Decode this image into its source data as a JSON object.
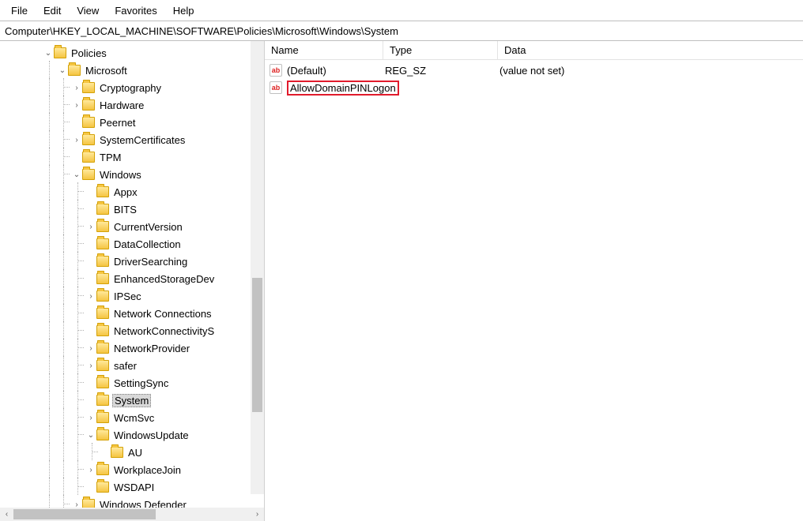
{
  "menu": {
    "file": "File",
    "edit": "Edit",
    "view": "View",
    "favorites": "Favorites",
    "help": "Help"
  },
  "address": "Computer\\HKEY_LOCAL_MACHINE\\SOFTWARE\\Policies\\Microsoft\\Windows\\System",
  "columns": {
    "name": "Name",
    "type": "Type",
    "data": "Data"
  },
  "values": [
    {
      "name": "(Default)",
      "type": "REG_SZ",
      "data": "(value not set)",
      "highlighted": false
    },
    {
      "name": "AllowDomainPINLogon",
      "type": "",
      "data": "",
      "highlighted": true
    }
  ],
  "tree": {
    "policies": "Policies",
    "microsoft": "Microsoft",
    "items": {
      "cryptography": "Cryptography",
      "hardware": "Hardware",
      "peernet": "Peernet",
      "systemcertificates": "SystemCertificates",
      "tpm": "TPM",
      "windows": "Windows",
      "appx": "Appx",
      "bits": "BITS",
      "currentversion": "CurrentVersion",
      "datacollection": "DataCollection",
      "driversearching": "DriverSearching",
      "enhancedstoragedev": "EnhancedStorageDev",
      "ipsec": "IPSec",
      "networkconnections": "Network Connections",
      "networkconnectivitys": "NetworkConnectivityS",
      "networkprovider": "NetworkProvider",
      "safer": "safer",
      "settingsync": "SettingSync",
      "system": "System",
      "wcmsvc": "WcmSvc",
      "windowsupdate": "WindowsUpdate",
      "au": "AU",
      "workplacejoin": "WorkplaceJoin",
      "wsdapi": "WSDAPI",
      "windowsdefender": "Windows Defender"
    }
  }
}
